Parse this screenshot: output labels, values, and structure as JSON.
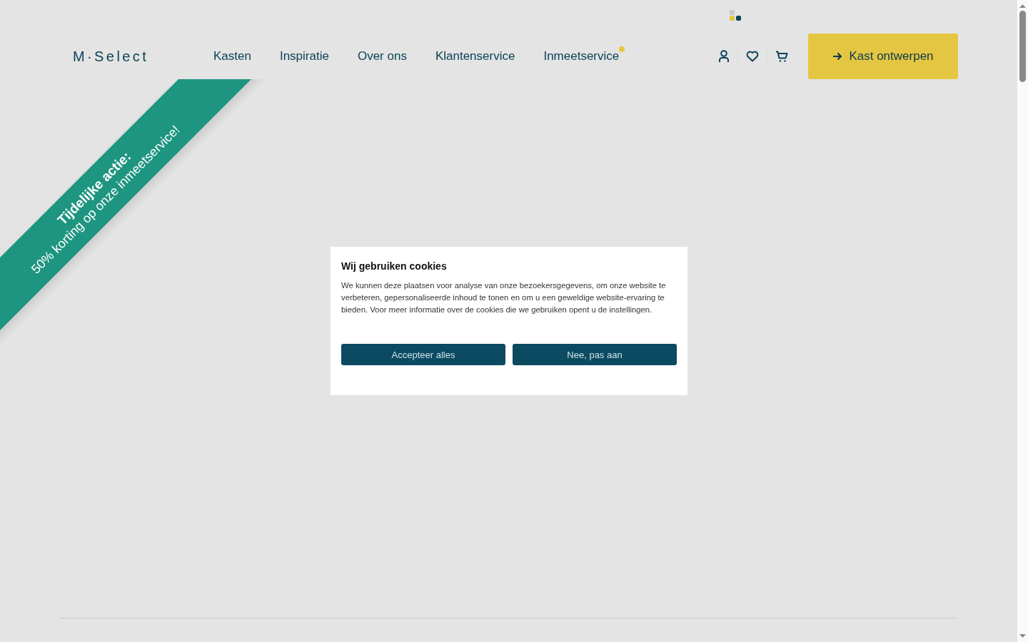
{
  "header": {
    "logo": "M·Select",
    "nav": [
      {
        "label": "Kasten",
        "dot": false
      },
      {
        "label": "Inspiratie",
        "dot": false
      },
      {
        "label": "Over ons",
        "dot": false
      },
      {
        "label": "Klantenservice",
        "dot": false
      },
      {
        "label": "Inmeetservice",
        "dot": true
      }
    ],
    "cta": "Kast ontwerpen"
  },
  "ribbon": {
    "title": "Tijdelijke actie:",
    "text": "50% korting op onze inmeetservice!"
  },
  "cookie_dialog": {
    "title": "Wij gebruiken cookies",
    "text": "We kunnen deze plaatsen voor analyse van onze bezoekersgegevens, om onze website te verbeteren, gepersonaliseerde inhoud te tonen en om u een geweldige website-ervaring te bieden. Voor meer informatie over de cookies die we gebruiken opent u de instellingen.",
    "buttons": [
      "Accepteer alles",
      "Nee, pas aan"
    ]
  }
}
